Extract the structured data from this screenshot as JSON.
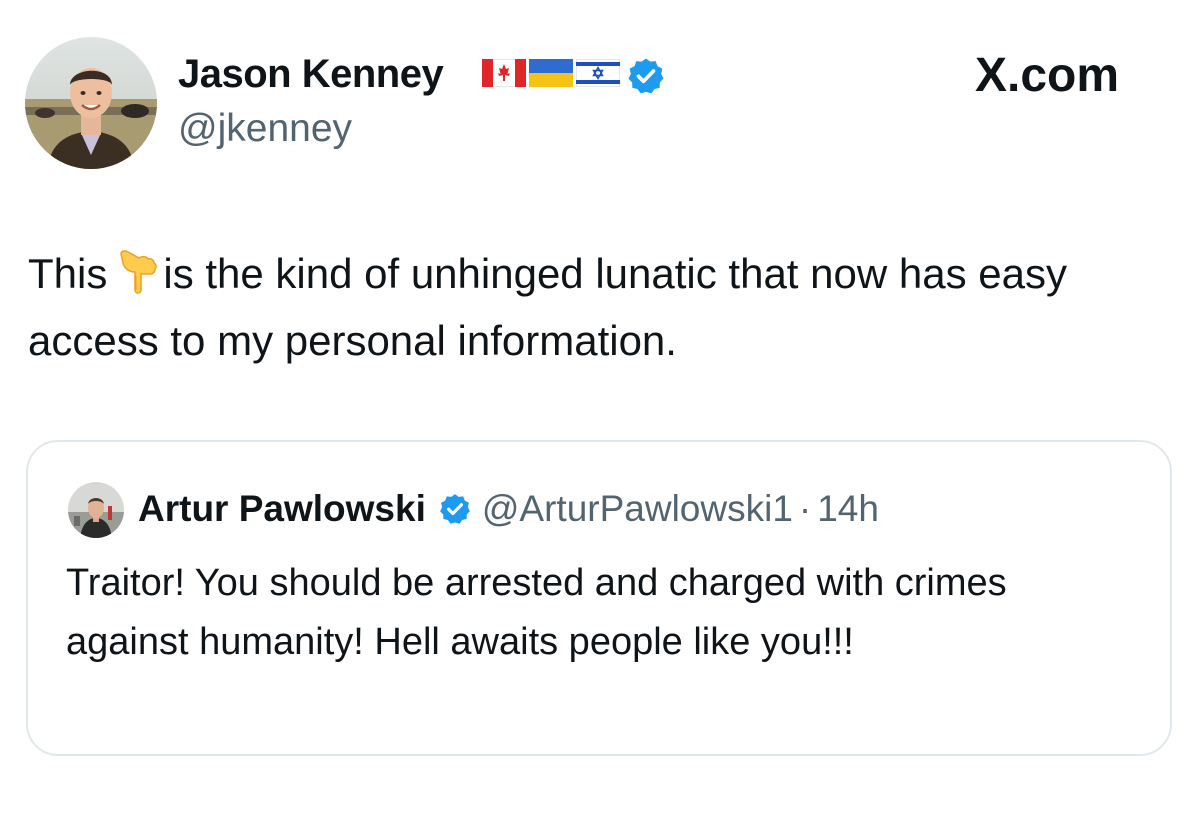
{
  "header": {
    "display_name": "Jason Kenney",
    "handle": "@jkenney",
    "flags": [
      "flag-canada",
      "flag-ukraine",
      "flag-israel"
    ],
    "verified_icon": "verified-badge-icon",
    "watermark": "X.com"
  },
  "tweet": {
    "text_before_emoji": "This",
    "emoji": "backhand-index-pointing-down-emoji",
    "text_after_emoji": "is the kind of unhinged lunatic that now has easy access to my personal information."
  },
  "quote": {
    "display_name": "Artur Pawlowski",
    "handle": "@ArturPawlowski1",
    "separator": "·",
    "time": "14h",
    "text": "Traitor! You should be arrested and charged with crimes against humanity! Hell awaits people like you!!!"
  },
  "colors": {
    "text_primary": "#0f1419",
    "text_secondary": "#536471",
    "verified_blue": "#1d9bf0",
    "card_border": "#e1e8ed"
  }
}
